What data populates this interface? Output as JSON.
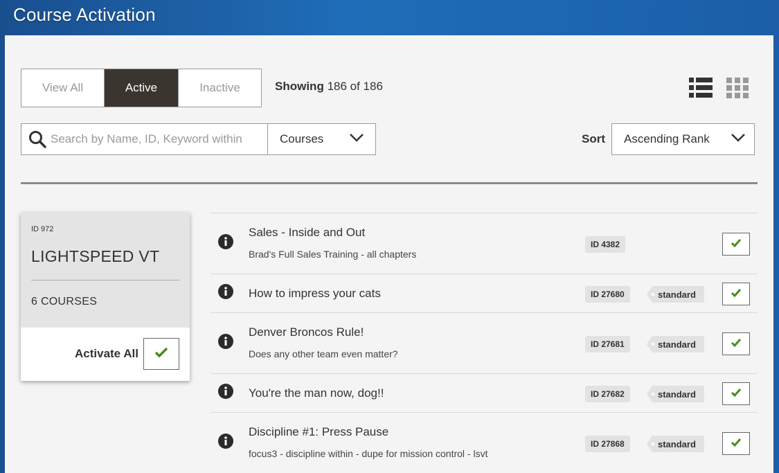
{
  "header": {
    "title": "Course Activation"
  },
  "filters": {
    "tabs": [
      {
        "label": "View All"
      },
      {
        "label": "Active"
      },
      {
        "label": "Inactive"
      }
    ],
    "active_tab": "Active",
    "showing_label": "Showing",
    "showing_count": "186 of 186"
  },
  "view_toggle": {
    "list_icon": "list-view-icon",
    "grid_icon": "grid-view-icon"
  },
  "search": {
    "placeholder": "Search by Name, ID, Keyword within",
    "value": "",
    "scope": "Courses"
  },
  "sort": {
    "label": "Sort",
    "value": "Ascending Rank"
  },
  "organization": {
    "id": "ID 972",
    "name": "LIGHTSPEED VT",
    "courses": "6 COURSES",
    "activate_all_label": "Activate All"
  },
  "courses": [
    {
      "title": "Sales - Inside and Out",
      "description": "Brad's Full Sales Training - all chapters",
      "id": "ID 4382",
      "tag": "",
      "active": true
    },
    {
      "title": "How to impress your cats",
      "description": "",
      "id": "ID 27680",
      "tag": "standard",
      "active": true
    },
    {
      "title": "Denver Broncos Rule!",
      "description": "Does any other team even matter?",
      "id": "ID 27681",
      "tag": "standard",
      "active": true
    },
    {
      "title": "You're the man now, dog!!",
      "description": "",
      "id": "ID 27682",
      "tag": "standard",
      "active": true
    },
    {
      "title": "Discipline #1: Press Pause",
      "description": "focus3 - discipline within - dupe for mission control - lsvt",
      "id": "ID 27868",
      "tag": "standard",
      "active": true
    }
  ],
  "colors": {
    "header_blue": "#1f6db8",
    "tab_active_bg": "#3b3530",
    "check_green": "#4a8a1f"
  }
}
